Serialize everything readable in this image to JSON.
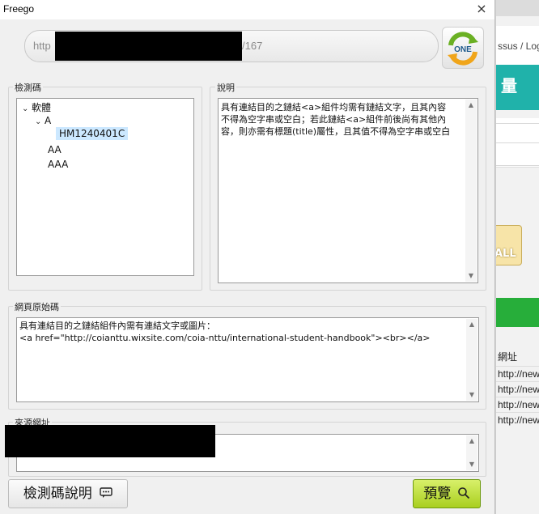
{
  "window": {
    "title": "Freego",
    "close_glyph": "×"
  },
  "url_bar": {
    "prefix": "http",
    "suffix": "/167",
    "redacted": true
  },
  "one_button": {
    "label": "ONE",
    "icon": "refresh-cycle-icon",
    "colors": {
      "arrow": "#6ab023",
      "arrow_dark": "#f0a51a"
    }
  },
  "check_code_panel": {
    "label": "檢測碼",
    "tree": [
      {
        "level": 0,
        "expanded": true,
        "label": "軟體"
      },
      {
        "level": 1,
        "expanded": true,
        "label": "A"
      },
      {
        "level": 2,
        "selected": true,
        "label": "HM1240401C"
      },
      {
        "level": 1,
        "label": "AA"
      },
      {
        "level": 1,
        "label": "AAA"
      }
    ]
  },
  "description_panel": {
    "label": "說明",
    "text": "具有連結目的之鏈結<a>組件均需有鏈結文字，且其內容不得為空字串或空白；若此鏈結<a>組件前後尚有其他內容，則亦需有標題(title)屬性，且其值不得為空字串或空白"
  },
  "page_source_panel": {
    "label": "網頁原始碼",
    "line1": "具有連結目的之鏈結組件內需有連結文字或圖片：",
    "line2": "<a href=\"http://coianttu.wixsite.com/coia-nttu/international-student-handbook\"><br></a>"
  },
  "source_url_panel": {
    "label": "來源網址",
    "redacted": true
  },
  "buttons": {
    "help": "檢測碼說明",
    "preview": "預覽"
  },
  "background_app": {
    "breadcrumb": "ssus / Log",
    "banner_glyph": "量",
    "all_button": "ALL",
    "column_header": "網址",
    "rows": [
      "http://new",
      "http://new",
      "http://new",
      "http://new"
    ],
    "colors": {
      "teal": "#20b2aa",
      "green": "#27ae3a"
    }
  }
}
